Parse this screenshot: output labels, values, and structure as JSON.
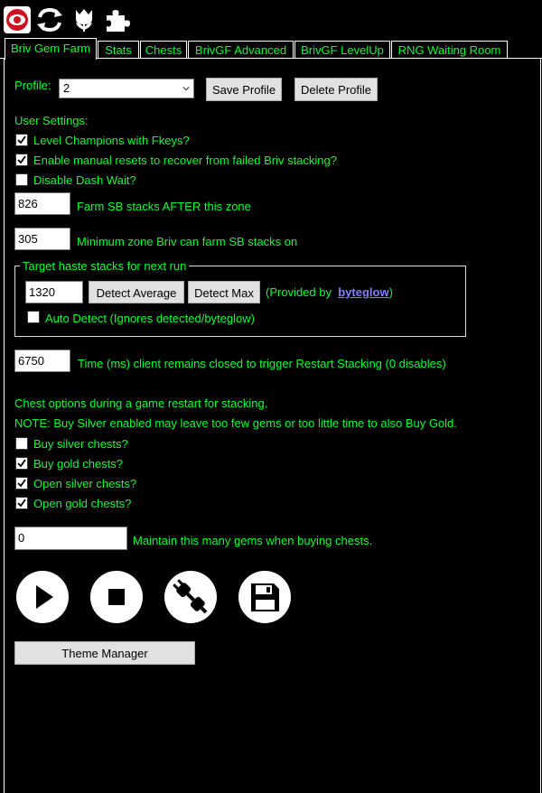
{
  "top_icons": [
    "eye-icon",
    "refresh-icon",
    "tulip-icon",
    "puzzle-icon"
  ],
  "tabs": [
    {
      "label": "Briv Gem Farm",
      "active": true
    },
    {
      "label": "Stats"
    },
    {
      "label": "Chests"
    },
    {
      "label": "BrivGF Advanced"
    },
    {
      "label": "BrivGF LevelUp"
    },
    {
      "label": "RNG Waiting Room"
    }
  ],
  "profile": {
    "label": "Profile:",
    "selected": "2",
    "save_label": "Save Profile",
    "delete_label": "Delete Profile"
  },
  "user_settings": {
    "heading": "User Settings:",
    "level_fkeys": {
      "label": "Level Champions with Fkeys?",
      "checked": true
    },
    "manual_resets": {
      "label": "Enable manual resets to recover from failed Briv stacking?",
      "checked": true
    },
    "disable_dash": {
      "label": "Disable Dash Wait?",
      "checked": false
    },
    "farm_zone": {
      "value": "826",
      "label": "Farm SB stacks AFTER this zone"
    },
    "min_zone": {
      "value": "305",
      "label": "Minimum zone Briv can farm SB stacks on"
    }
  },
  "haste": {
    "title": "Target haste stacks for next run",
    "value": "1320",
    "detect_average_label": "Detect Average",
    "detect_max_label": "Detect Max",
    "provided_prefix": "(Provided by",
    "provided_link": "byteglow",
    "provided_suffix": ")",
    "auto_detect": {
      "label": "Auto Detect (Ignores detected/byteglow)",
      "checked": false
    }
  },
  "restart": {
    "value": "6750",
    "label": "Time (ms) client remains closed to trigger Restart Stacking (0 disables)"
  },
  "chests": {
    "heading": "Chest options during a game restart for stacking.",
    "note": "NOTE: Buy Silver enabled may leave too few gems or too little time to also Buy Gold.",
    "buy_silver": {
      "label": "Buy silver chests?",
      "checked": false
    },
    "buy_gold": {
      "label": "Buy gold chests?",
      "checked": true
    },
    "open_silver": {
      "label": "Open silver chests?",
      "checked": true
    },
    "open_gold": {
      "label": "Open gold chests?",
      "checked": true
    },
    "gems": {
      "value": "0",
      "label": "Maintain this many gems when buying chests."
    }
  },
  "controls": [
    "play-icon",
    "stop-icon",
    "connect-icon",
    "save-icon"
  ],
  "theme_manager_label": "Theme Manager",
  "colors": {
    "text": "#00ff33",
    "background": "#000000",
    "link": "#8080ff"
  }
}
